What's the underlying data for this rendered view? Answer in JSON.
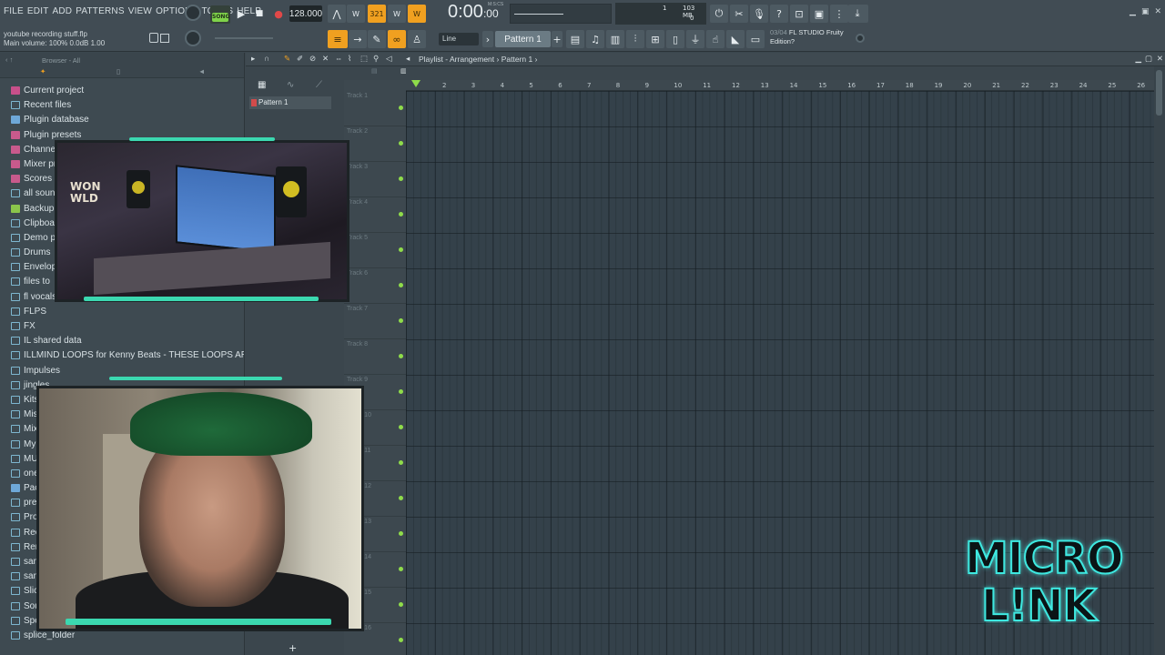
{
  "menu": [
    "FILE",
    "EDIT",
    "ADD",
    "PATTERNS",
    "VIEW",
    "OPTIONS",
    "TOOLS",
    "HELP"
  ],
  "hint": {
    "line1": "youtube recording stuff.flp",
    "line2": "Main volume: 100% 0.0dB  1.00"
  },
  "transport": {
    "song_label": "SONG",
    "tempo": "128.000",
    "time": "0:00",
    "time_small": ":00",
    "time_unit": "M:S:CS",
    "memory": "103 MB",
    "cpu_left": "1",
    "cpu_right": "0"
  },
  "toolbar2": {
    "snap": "Line",
    "pattern": "Pattern 1"
  },
  "news": {
    "index": "03/04",
    "text": "FL STUDIO Fruity Edition?"
  },
  "browser": {
    "header": "Browser - All",
    "items": [
      {
        "label": "Current project",
        "icon": "ico-red"
      },
      {
        "label": "Recent files",
        "icon": "folder"
      },
      {
        "label": "Plugin database",
        "icon": "ico-blue"
      },
      {
        "label": "Plugin presets",
        "icon": "ico-pink"
      },
      {
        "label": "Channel presets",
        "icon": "ico-pink"
      },
      {
        "label": "Mixer presets",
        "icon": "ico-pink"
      },
      {
        "label": "Scores",
        "icon": "ico-pink"
      },
      {
        "label": "all sounds",
        "icon": "folder"
      },
      {
        "label": "Backup",
        "icon": "ico-green"
      },
      {
        "label": "Clipboard files",
        "icon": "folder"
      },
      {
        "label": "Demo projects",
        "icon": "folder"
      },
      {
        "label": "Drums",
        "icon": "folder"
      },
      {
        "label": "Envelopes",
        "icon": "folder"
      },
      {
        "label": "files to",
        "icon": "folder"
      },
      {
        "label": "fl vocals revc ect",
        "icon": "folder"
      },
      {
        "label": "FLPS",
        "icon": "folder"
      },
      {
        "label": "FX",
        "icon": "folder"
      },
      {
        "label": "IL shared data",
        "icon": "folder"
      },
      {
        "label": "ILLMIND LOOPS for Kenny Beats - THESE LOOPS ARE FIRE",
        "icon": "folder"
      },
      {
        "label": "Impulses",
        "icon": "folder"
      },
      {
        "label": "jingles",
        "icon": "folder"
      },
      {
        "label": "Kits",
        "icon": "folder"
      },
      {
        "label": "Misc",
        "icon": "folder"
      },
      {
        "label": "Mixer",
        "icon": "folder"
      },
      {
        "label": "My projects",
        "icon": "folder"
      },
      {
        "label": "MUSIC",
        "icon": "folder"
      },
      {
        "label": "one shots",
        "icon": "folder"
      },
      {
        "label": "Packs",
        "icon": "ico-blue"
      },
      {
        "label": "presets",
        "icon": "folder"
      },
      {
        "label": "Projects",
        "icon": "folder"
      },
      {
        "label": "Recorded",
        "icon": "folder"
      },
      {
        "label": "Rendered",
        "icon": "folder"
      },
      {
        "label": "samples",
        "icon": "folder"
      },
      {
        "label": "sample kits",
        "icon": "folder"
      },
      {
        "label": "Sliced audio",
        "icon": "folder"
      },
      {
        "label": "Soundfonts",
        "icon": "folder"
      },
      {
        "label": "Speech",
        "icon": "folder"
      },
      {
        "label": "splice_folder",
        "icon": "folder"
      }
    ]
  },
  "channel": {
    "pattern_item": "Pattern 1",
    "add": "+"
  },
  "playlist": {
    "title": "Playlist - Arrangement",
    "crumb": "Pattern 1",
    "tracks": [
      "Track 1",
      "Track 2",
      "Track 3",
      "Track 4",
      "Track 5",
      "Track 6",
      "Track 7",
      "Track 8",
      "Track 9",
      "Track 10",
      "Track 11",
      "Track 12",
      "Track 13",
      "Track 14",
      "Track 15",
      "Track 16"
    ],
    "ruler": [
      "2",
      "3",
      "4",
      "5",
      "6",
      "7",
      "8",
      "9",
      "10",
      "11",
      "12",
      "13",
      "14",
      "15",
      "16",
      "17",
      "18",
      "19",
      "20",
      "21",
      "22",
      "23",
      "24",
      "25",
      "26"
    ]
  },
  "logo": {
    "line1": "MICRO",
    "line2": "L!NK"
  },
  "cam1": {
    "caption": "WON\nWLD"
  }
}
